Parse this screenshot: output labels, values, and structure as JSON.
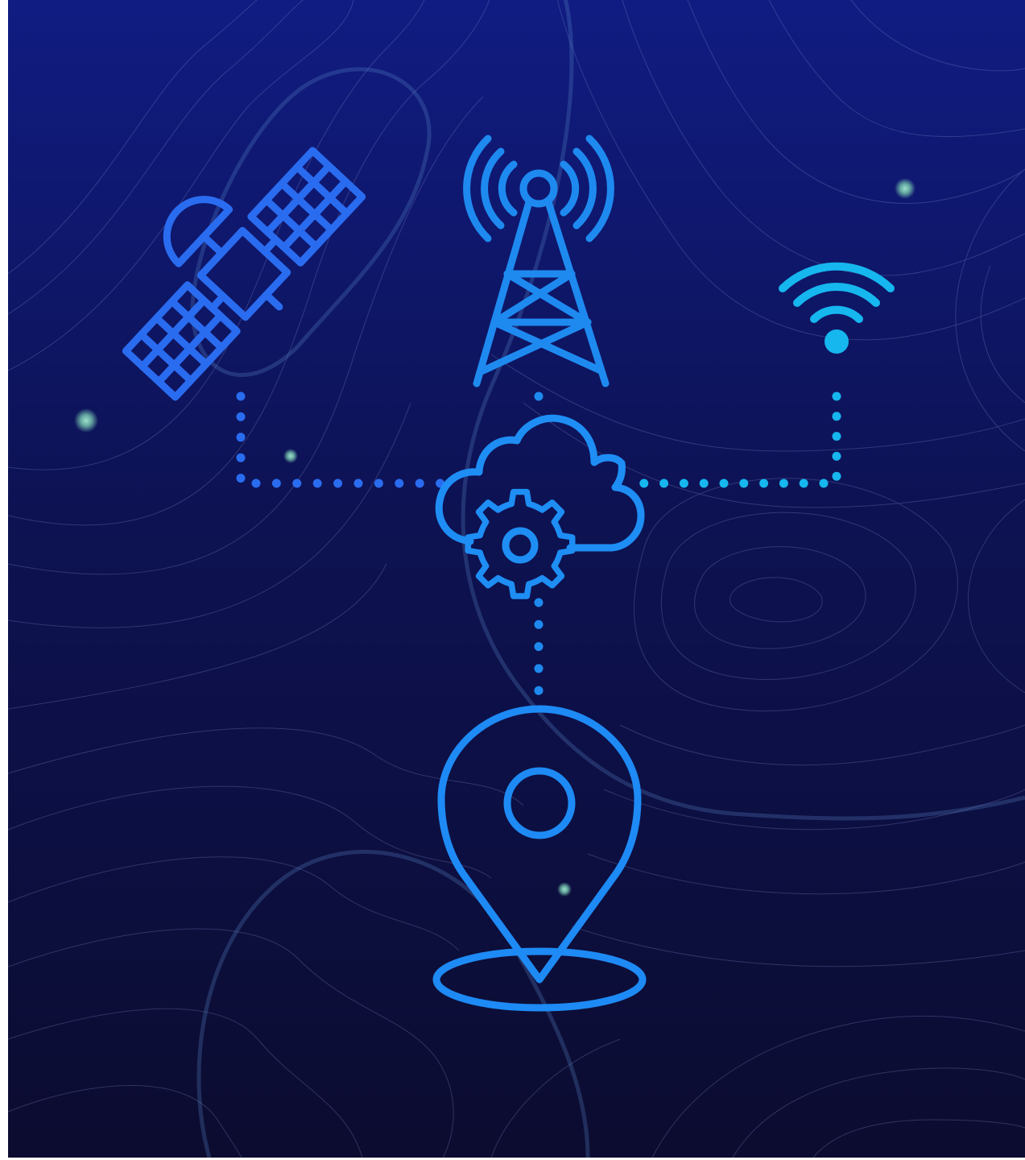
{
  "colors": {
    "bg_top": "#101c82",
    "bg_mid": "#0d1252",
    "bg_bottom": "#0c0c30",
    "satellite": "#2a6cf0",
    "tower": "#1e8af0",
    "wifi": "#16b6ee",
    "cloud_gear": "#1e8ef5",
    "pin": "#1e8af5",
    "contour": "#8a96d2",
    "contour_bold": "#5a88c8",
    "glow_dot": "#79c9b8"
  },
  "icons": {
    "satellite": "satellite-icon",
    "tower": "cell-tower-icon",
    "wifi": "wifi-icon",
    "cloud": "cloud-gear-icon",
    "pin": "location-pin-icon"
  }
}
